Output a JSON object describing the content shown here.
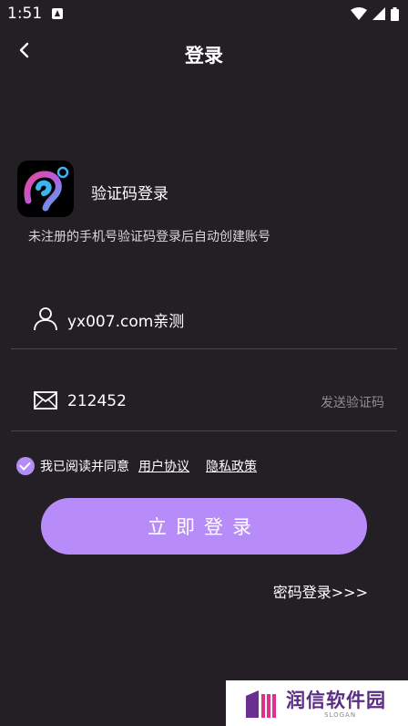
{
  "status_bar": {
    "time": "1:51"
  },
  "header": {
    "title": "登录"
  },
  "login": {
    "heading": "验证码登录",
    "subtitle": "未注册的手机号验证码登录后自动创建账号",
    "phone_value": "yx007.com亲测",
    "code_value": "212452",
    "send_code_label": "发送验证码",
    "agree_text": "我已阅读并同意",
    "agreement_checked": true,
    "user_agreement_label": "用户协议",
    "privacy_policy_label": "隐私政策",
    "submit_label": "立即登录",
    "password_login_label": "密码登录>>>"
  },
  "watermark": {
    "text": "润信软件园",
    "slogan": "SLOGAN"
  },
  "colors": {
    "accent": "#b78cf8",
    "background": "#231f24"
  }
}
